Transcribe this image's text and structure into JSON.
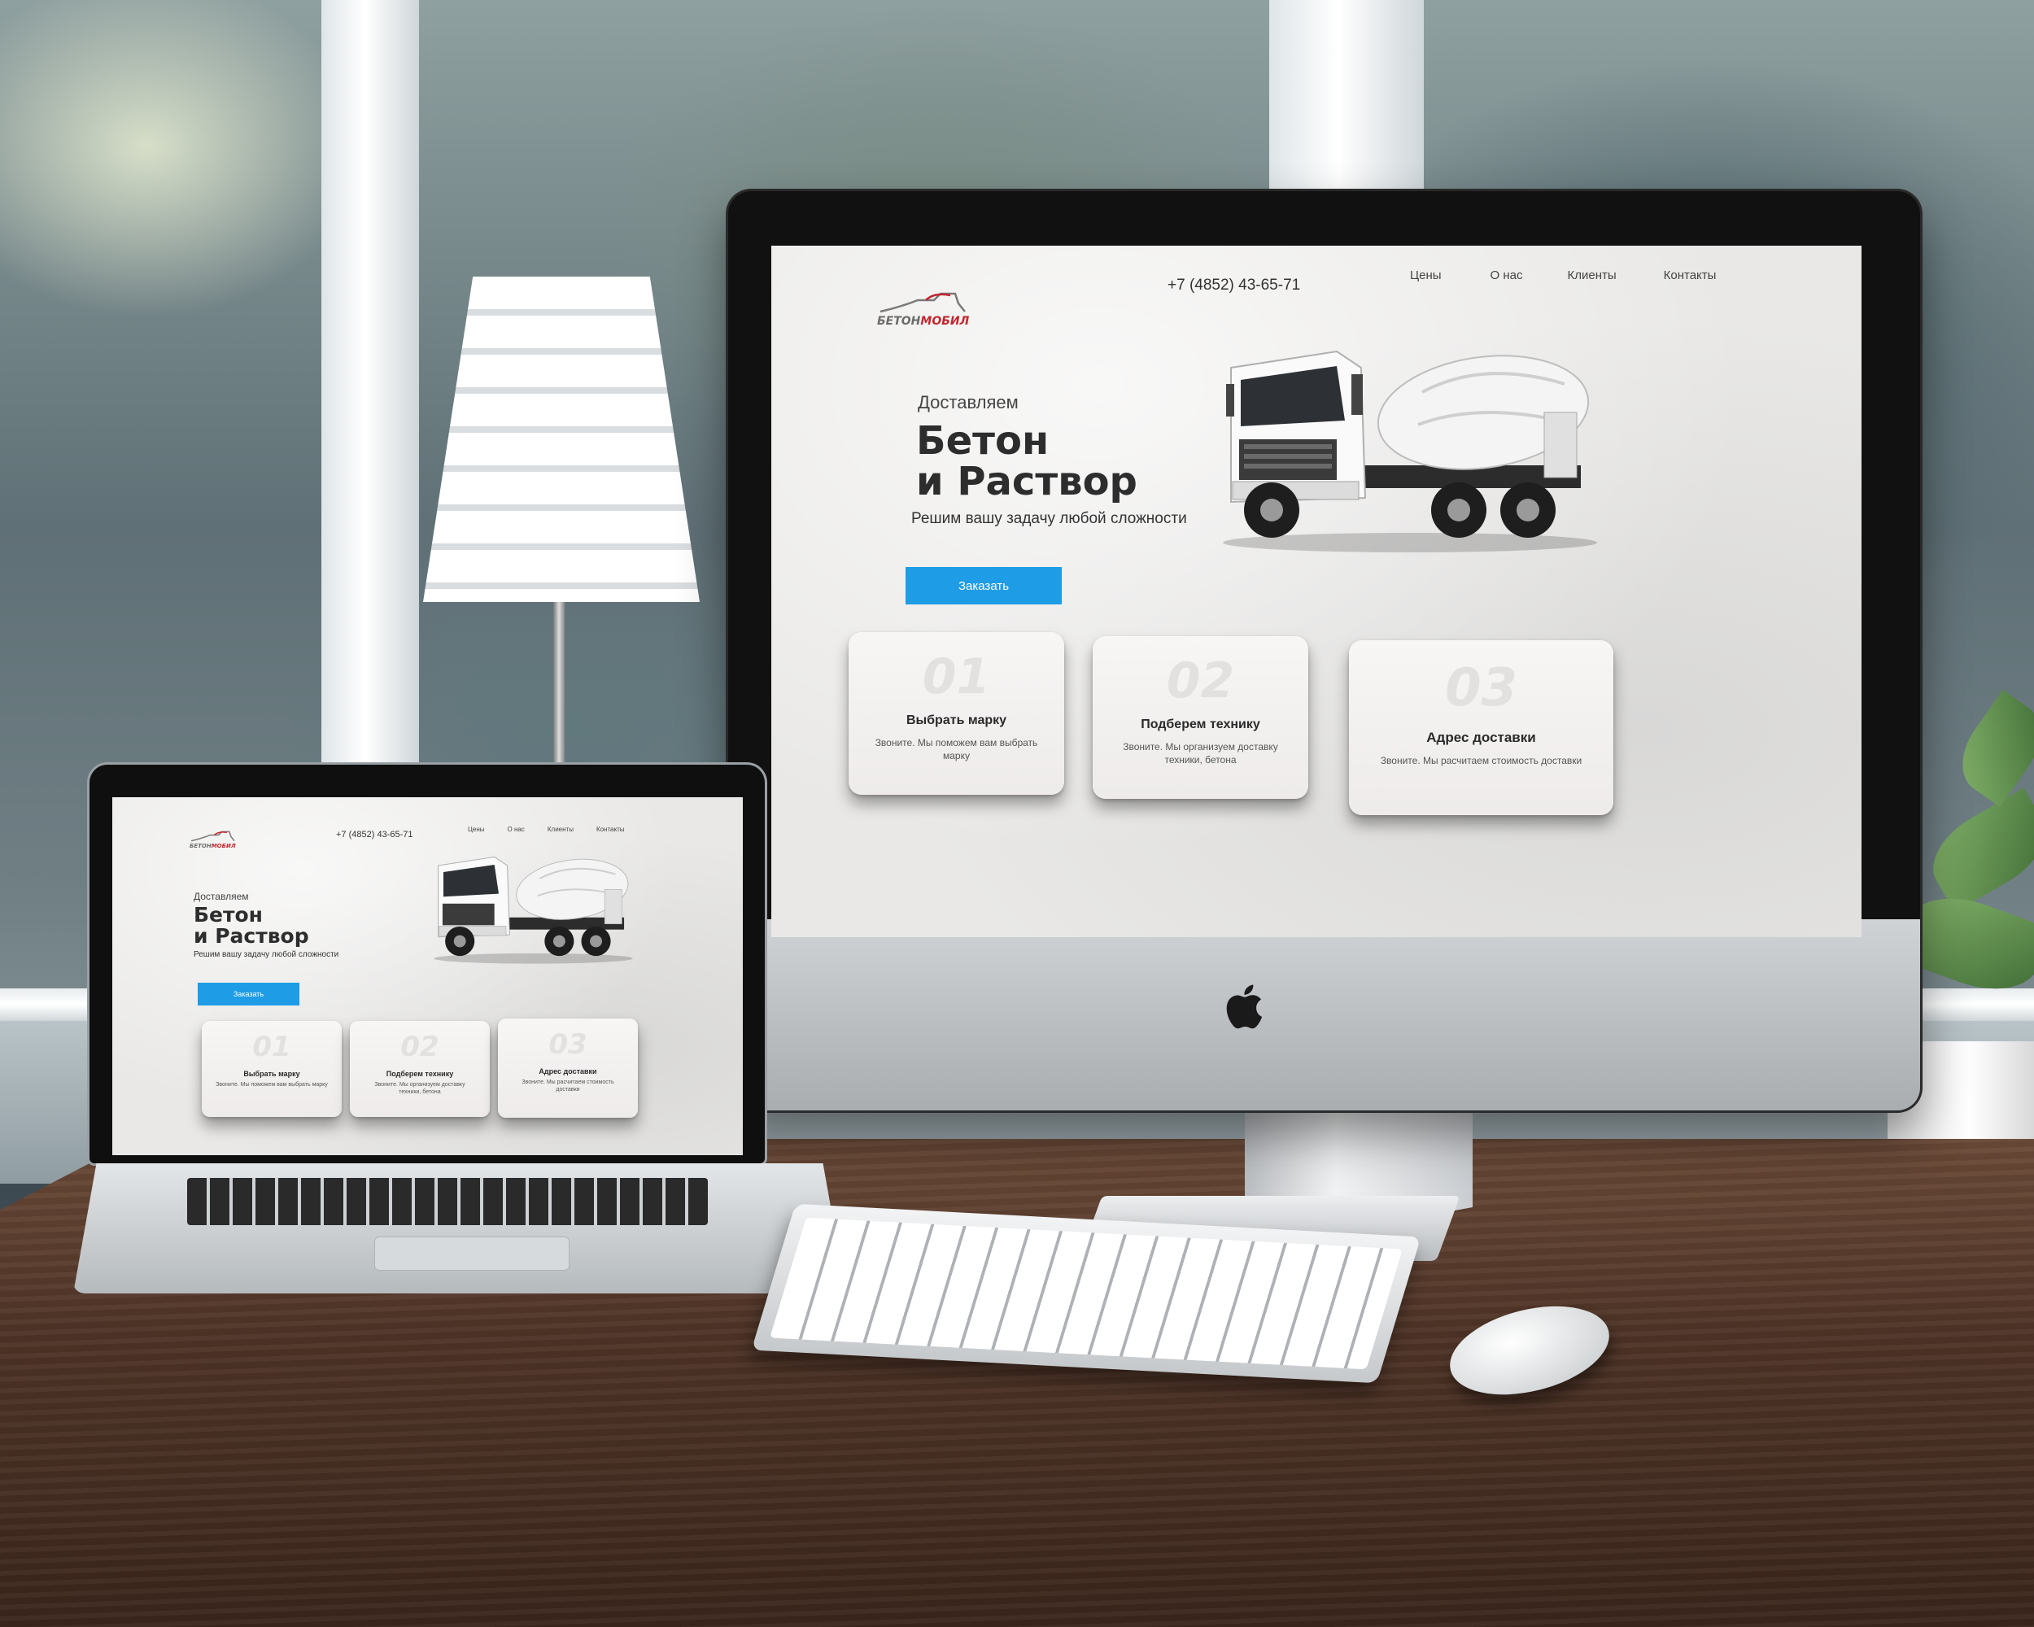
{
  "brand": {
    "logo_part1": "БЕТОН",
    "logo_part2": "МОБИЛ",
    "accent_color": "#1e9ce6",
    "logo_red": "#c2262e"
  },
  "header": {
    "phone": "+7 (4852) 43-65-71",
    "nav": [
      "Цены",
      "О нас",
      "Клиенты",
      "Контакты"
    ]
  },
  "hero": {
    "subtitle": "Доставляем",
    "title_line1": "Бетон",
    "title_line2": "и Раствор",
    "tagline": "Решим вашу задачу любой сложности",
    "cta_label": "Заказать",
    "image": "concrete-mixer-truck"
  },
  "features": [
    {
      "num": "01",
      "title": "Выбрать марку",
      "text": "Звоните. Мы поможем вам выбрать марку"
    },
    {
      "num": "02",
      "title": "Подберем технику",
      "text": "Звоните. Мы организуем доставку техники, бетона"
    },
    {
      "num": "03",
      "title": "Адрес доставки",
      "text": "Звоните. Мы расчитаем стоимость доставки"
    }
  ],
  "devices": {
    "desktop_logo_icon": "apple-logo-icon"
  }
}
